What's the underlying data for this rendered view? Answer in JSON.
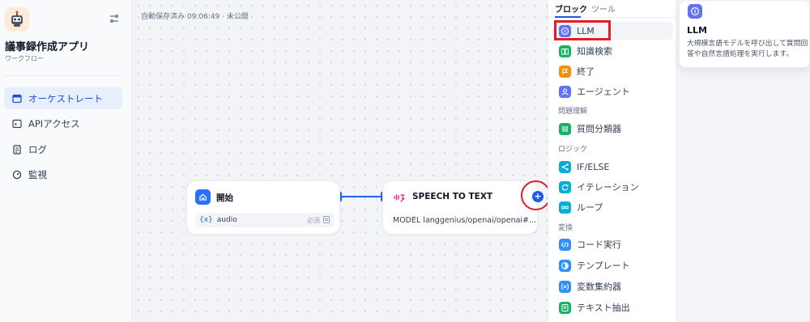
{
  "app": {
    "title": "議事録作成アプリ",
    "subtitle": "ワークフロー"
  },
  "sidebar": {
    "items": [
      {
        "label": "オーケストレート",
        "icon": "layout-icon",
        "active": true
      },
      {
        "label": "APIアクセス",
        "icon": "terminal-icon"
      },
      {
        "label": "ログ",
        "icon": "log-icon"
      },
      {
        "label": "監視",
        "icon": "gauge-icon"
      }
    ]
  },
  "canvas": {
    "status": "自動保存済み 09:06:49 · 未公開",
    "start_node": {
      "title": "開始",
      "variable": "audio",
      "variable_brace": "{x}",
      "variable_meta": "必須"
    },
    "stt_node": {
      "title": "SPEECH TO TEXT",
      "model": "MODEL langgenius/openai/openai#..."
    },
    "add_button": "+"
  },
  "block_menu": {
    "tabs": [
      "ブロック",
      "ツール"
    ],
    "items": [
      {
        "label": "LLM",
        "icon": "llm-icon",
        "color": "#6172f3"
      },
      {
        "label": "知識検索",
        "icon": "knowledge-icon",
        "color": "#16b364"
      },
      {
        "label": "終了",
        "icon": "end-icon",
        "color": "#f79009"
      },
      {
        "label": "エージェント",
        "icon": "agent-icon",
        "color": "#6172f3"
      }
    ],
    "section_problem": "問題理解",
    "problem_items": [
      {
        "label": "質問分類器",
        "icon": "classifier-icon",
        "color": "#16b364"
      }
    ],
    "section_logic": "ロジック",
    "logic_items": [
      {
        "label": "IF/ELSE",
        "icon": "ifelse-icon",
        "color": "#06aed4"
      },
      {
        "label": "イテレーション",
        "icon": "iteration-icon",
        "color": "#06aed4"
      },
      {
        "label": "ループ",
        "icon": "loop-icon",
        "color": "#06aed4"
      }
    ],
    "section_transform": "変換",
    "transform_items": [
      {
        "label": "コード実行",
        "icon": "code-icon",
        "color": "#2e90fa"
      },
      {
        "label": "テンプレート",
        "icon": "template-icon",
        "color": "#2e90fa"
      },
      {
        "label": "変数集約器",
        "icon": "aggregator-icon",
        "color": "#2e90fa"
      },
      {
        "label": "テキスト抽出",
        "icon": "extract-icon",
        "color": "#16b364"
      }
    ]
  },
  "tooltip": {
    "title": "LLM",
    "description": "大規模言語モデルを呼び出して質問回答や自然言語処理を実行します。"
  }
}
